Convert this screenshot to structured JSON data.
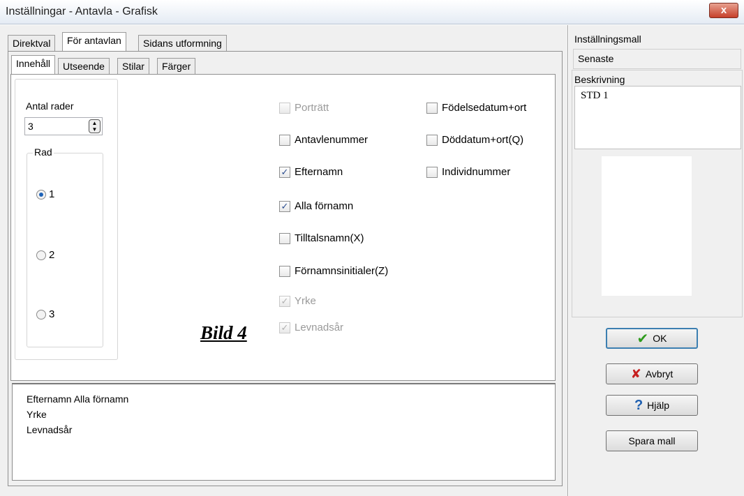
{
  "window": {
    "title": "Inställningar - Antavla - Grafisk",
    "close_glyph": "x"
  },
  "top_tabs": [
    {
      "label": "Direktval"
    },
    {
      "label": "För antavlan"
    },
    {
      "label": "Sidans utformning"
    }
  ],
  "sub_tabs": [
    {
      "label": "Innehåll"
    },
    {
      "label": "Utseende"
    },
    {
      "label": "Stilar"
    },
    {
      "label": "Färger"
    }
  ],
  "rows": {
    "label": "Antal rader",
    "value": "3",
    "group_label": "Rad",
    "options": [
      {
        "label": "1",
        "selected": true
      },
      {
        "label": "2",
        "selected": false
      },
      {
        "label": "3",
        "selected": false
      }
    ]
  },
  "checks_col1": [
    {
      "label": "Porträtt",
      "checked": false,
      "disabled": true
    },
    {
      "label": "Antavlenummer",
      "checked": false,
      "disabled": false
    },
    {
      "label": "Efternamn",
      "checked": true,
      "disabled": false
    },
    {
      "label": "Alla förnamn",
      "checked": true,
      "disabled": false
    },
    {
      "label": "Tilltalsnamn(X)",
      "checked": false,
      "disabled": false
    },
    {
      "label": "Förnamnsinitialer(Z)",
      "checked": false,
      "disabled": false
    },
    {
      "label": "Yrke",
      "checked": true,
      "disabled": true
    },
    {
      "label": "Levnadsår",
      "checked": true,
      "disabled": true
    }
  ],
  "checks_col2": [
    {
      "label": "Födelsedatum+ort",
      "checked": false
    },
    {
      "label": "Döddatum+ort(Q)",
      "checked": false
    },
    {
      "label": "Individnummer",
      "checked": false
    }
  ],
  "annotation": "Bild 4",
  "preview_lines": [
    "Efternamn Alla förnamn",
    "Yrke",
    "Levnadsår"
  ],
  "template": {
    "label": "Inställningsmall",
    "value": "Senaste",
    "desc_label": "Beskrivning",
    "desc_value": "STD 1"
  },
  "buttons": {
    "ok": "OK",
    "cancel": "Avbryt",
    "help": "Hjälp",
    "save": "Spara mall"
  },
  "colors": {
    "check": "#2b4d8f",
    "ok_icon": "#2f9b1d",
    "cancel_icon": "#c62020",
    "help_icon": "#1e5fb0"
  }
}
